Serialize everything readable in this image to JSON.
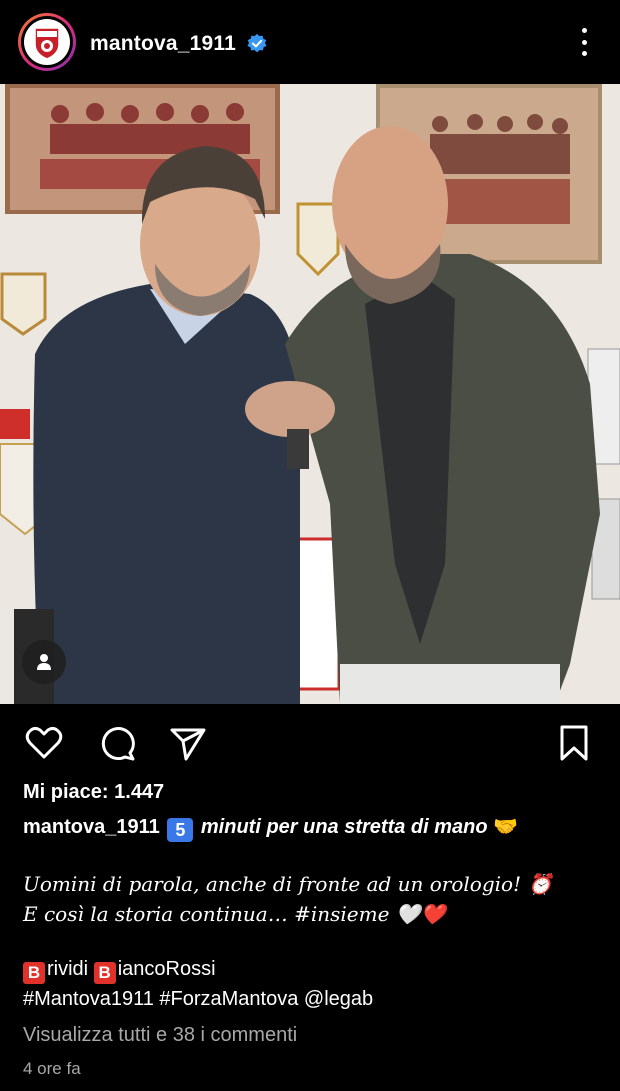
{
  "header": {
    "username": "mantova_1911",
    "avatar_icon": "mantova-club-crest",
    "verified_icon": "verified-badge-icon",
    "more_icon": "more-vertical-icon"
  },
  "photo": {
    "description_icon": "post-photo",
    "tag_icon": "user-tag-icon"
  },
  "actions": {
    "like_icon": "heart-icon",
    "comment_icon": "comment-icon",
    "share_icon": "send-icon",
    "save_icon": "bookmark-icon"
  },
  "post": {
    "likes_text": "Mi piace: 1.447",
    "caption_username": "mantova_1911",
    "caption_number": "5",
    "caption_headline": "minuti per una stretta di mano",
    "caption_headline_emoji": "🤝",
    "line_1": "Uomini di parola, anche di fronte ad un orologio!",
    "line_1_emoji": "⏰",
    "line_2": "E così la storia continua… #insieme",
    "line_2_emoji": "🤍❤️",
    "tag_letter": "B",
    "tag_word_1": "rividi",
    "tag_word_2": "iancoRossi",
    "hashtags": "#Mantova1911 #ForzaMantova @legab",
    "view_comments": "Visualizza tutti e 38 i commenti",
    "timestamp": "4 ore fa"
  },
  "colors": {
    "background": "#000000",
    "secondary_text": "#a8a8a8",
    "verified": "#3897f0",
    "keycap": "#3b78e7",
    "b_emoji": "#e0312a"
  }
}
